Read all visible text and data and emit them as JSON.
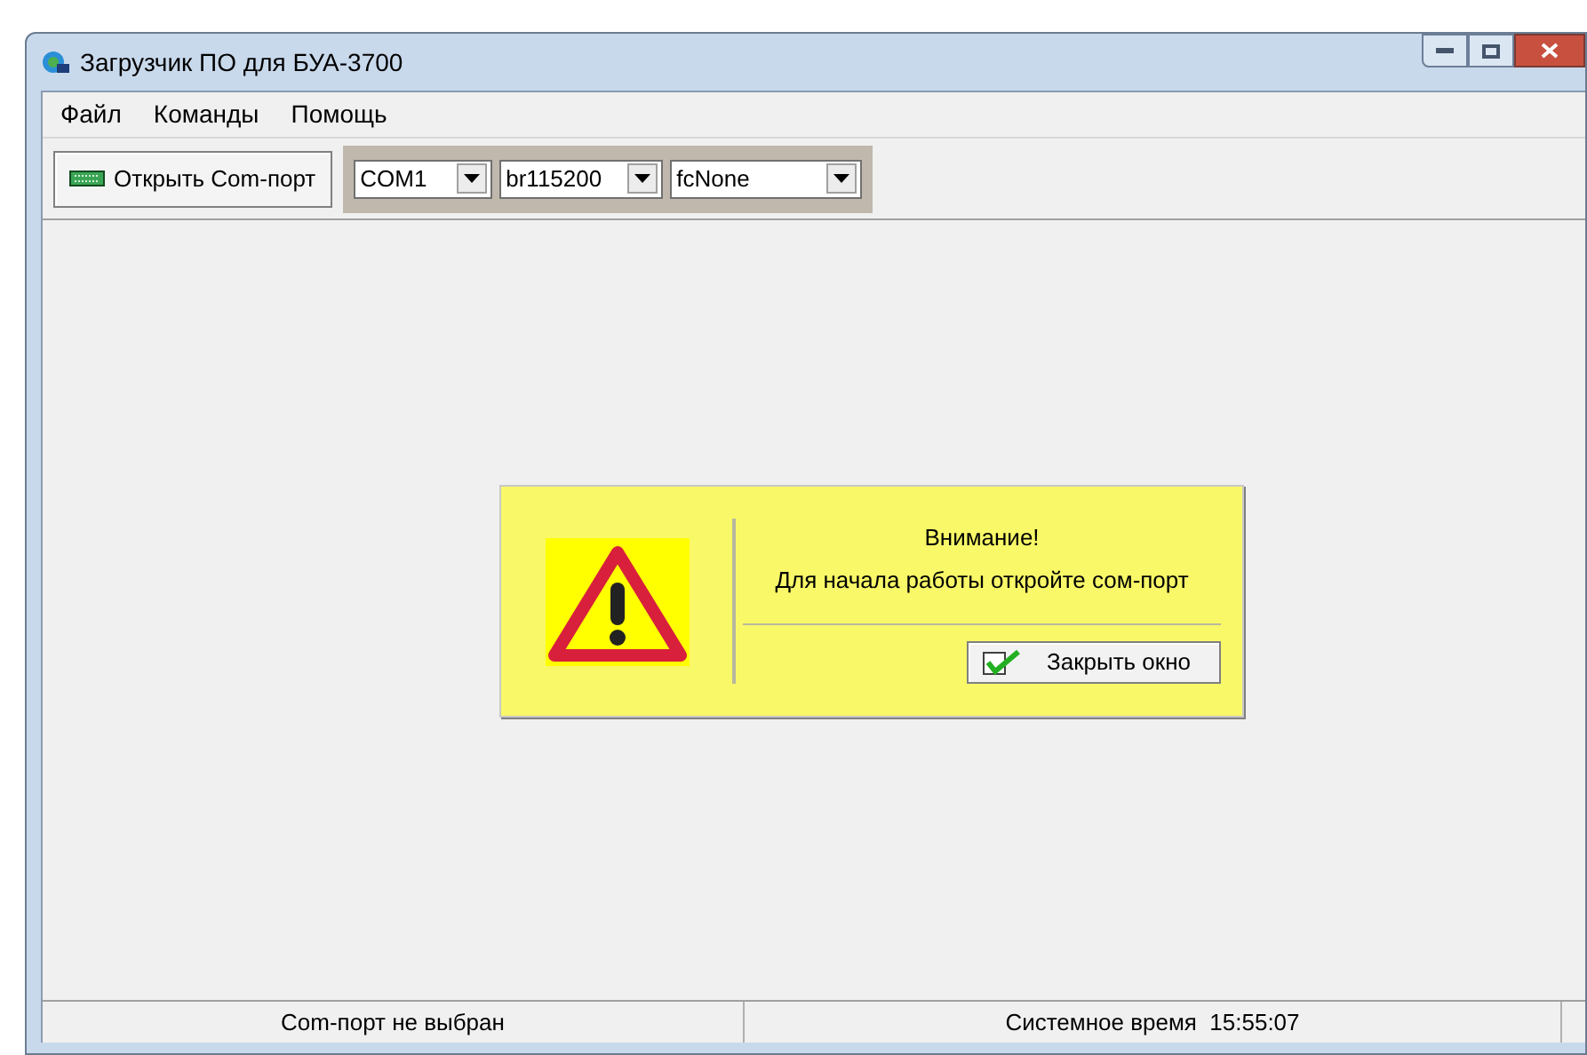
{
  "window": {
    "title": "Загрузчик ПО для БУА-3700"
  },
  "menu": [
    "Файл",
    "Команды",
    "Помощь"
  ],
  "toolbar": {
    "open_button": "Открыть Com-порт",
    "selects": [
      "COM1",
      "br115200",
      "fcNone"
    ]
  },
  "dialog": {
    "title": "Внимание!",
    "message": "Для начала работы откройте сом-порт",
    "button": "Закрыть окно"
  },
  "status_bar": [
    "Com-порт не выбран",
    "Системное время  15:55:07"
  ]
}
